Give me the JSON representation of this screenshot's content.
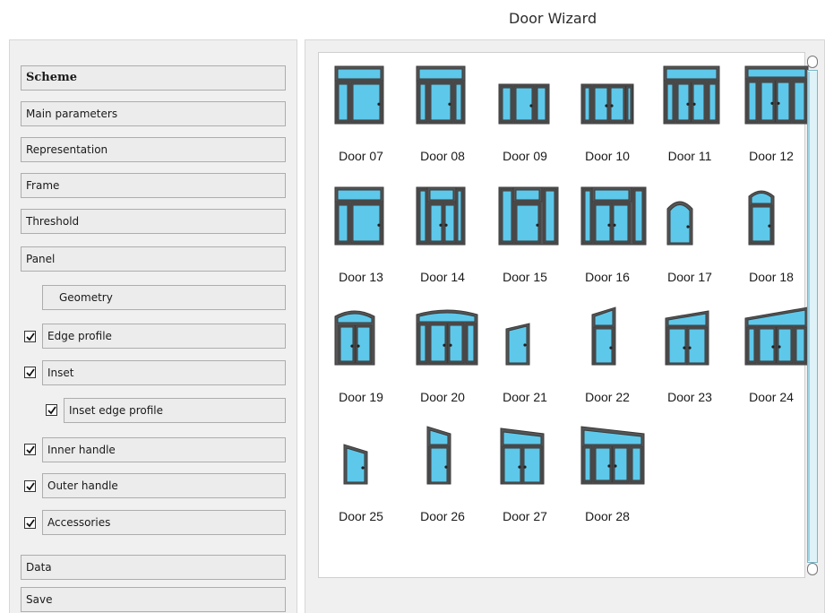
{
  "window": {
    "title": "Door Wizard"
  },
  "sidebar": {
    "items": [
      {
        "label": "Scheme"
      },
      {
        "label": "Main parameters"
      },
      {
        "label": "Representation"
      },
      {
        "label": "Frame"
      },
      {
        "label": "Threshold"
      },
      {
        "label": "Panel"
      },
      {
        "label": "Geometry"
      },
      {
        "label": "Edge profile",
        "checked": true
      },
      {
        "label": "Inset",
        "checked": true
      },
      {
        "label": "Inset edge profile",
        "checked": true
      },
      {
        "label": "Inner handle",
        "checked": true
      },
      {
        "label": "Outer handle",
        "checked": true
      },
      {
        "label": "Accessories",
        "checked": true
      },
      {
        "label": "Data"
      },
      {
        "label": "Save"
      }
    ]
  },
  "gallery": {
    "colors": {
      "glass": "#5ec8ea",
      "frame": "#555555",
      "frame_dark": "#3a3a3a"
    },
    "doors": [
      {
        "label": "Door 07",
        "icon": "door-transom-single-sidelight-icon"
      },
      {
        "label": "Door 08",
        "icon": "door-transom-single-sidelights-icon"
      },
      {
        "label": "Door 09",
        "icon": "door-single-sidelights-icon"
      },
      {
        "label": "Door 10",
        "icon": "door-double-sidelights-icon"
      },
      {
        "label": "Door 11",
        "icon": "door-transom-double-sidelights-icon"
      },
      {
        "label": "Door 12",
        "icon": "door-transom-wide-sidelights-icon"
      },
      {
        "label": "Door 13",
        "icon": "door-transom-sidelight-icon"
      },
      {
        "label": "Door 14",
        "icon": "door-transom-center-icon"
      },
      {
        "label": "Door 15",
        "icon": "door-transom-center-sidelights-icon"
      },
      {
        "label": "Door 16",
        "icon": "door-transom-center-sidelight-right-icon"
      },
      {
        "label": "Door 17",
        "icon": "door-arched-icon"
      },
      {
        "label": "Door 18",
        "icon": "door-arched-transom-icon"
      },
      {
        "label": "Door 19",
        "icon": "door-arched-transom-double-icon"
      },
      {
        "label": "Door 20",
        "icon": "door-segment-arch-sidelights-icon"
      },
      {
        "label": "Door 21",
        "icon": "door-sloped-top-icon"
      },
      {
        "label": "Door 22",
        "icon": "door-sloped-transom-icon"
      },
      {
        "label": "Door 23",
        "icon": "door-sloped-transom-double-icon"
      },
      {
        "label": "Door 24",
        "icon": "door-sloped-transom-sidelights-icon"
      },
      {
        "label": "Door 25",
        "icon": "door-sloped-top-left-icon"
      },
      {
        "label": "Door 26",
        "icon": "door-sloped-transom-left-icon"
      },
      {
        "label": "Door 27",
        "icon": "door-sloped-transom-double-left-icon"
      },
      {
        "label": "Door 28",
        "icon": "door-sloped-transom-sidelights-left-icon"
      }
    ]
  },
  "scrollbar": {
    "position": 0
  }
}
